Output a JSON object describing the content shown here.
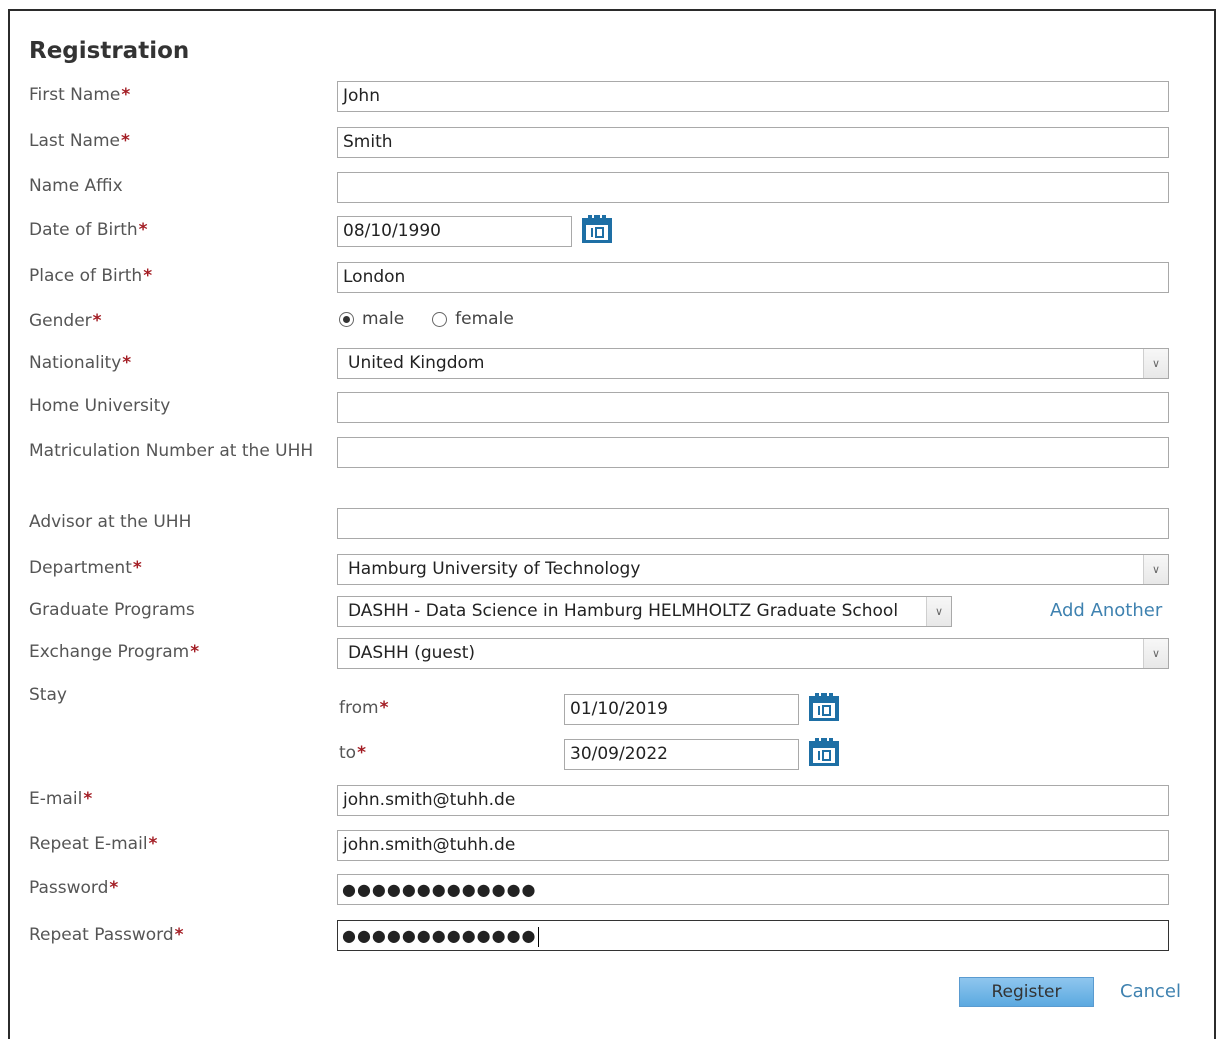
{
  "title": "Registration",
  "required_mark": "*",
  "fields": {
    "first_name": {
      "label": "First Name",
      "value": "John"
    },
    "last_name": {
      "label": "Last Name",
      "value": "Smith"
    },
    "name_affix": {
      "label": "Name Affix",
      "value": ""
    },
    "date_of_birth": {
      "label": "Date of Birth",
      "value": "08/10/1990"
    },
    "place_of_birth": {
      "label": "Place of Birth",
      "value": "London"
    },
    "gender": {
      "label": "Gender",
      "options": [
        "male",
        "female"
      ],
      "selected": "male"
    },
    "nationality": {
      "label": "Nationality",
      "value": "United Kingdom"
    },
    "home_university": {
      "label": "Home University",
      "value": ""
    },
    "matriculation_number": {
      "label": "Matriculation Number at the UHH",
      "value": ""
    },
    "advisor": {
      "label": "Advisor at the UHH",
      "value": ""
    },
    "department": {
      "label": "Department",
      "value": "Hamburg University of Technology"
    },
    "graduate_programs": {
      "label": "Graduate Programs",
      "value": "DASHH - Data Science in Hamburg HELMHOLTZ Graduate School",
      "add_another": "Add Another"
    },
    "exchange_program": {
      "label": "Exchange Program",
      "value": "DASHH (guest)"
    },
    "stay": {
      "label": "Stay",
      "from_label": "from",
      "from_value": "01/10/2019",
      "to_label": "to",
      "to_value": "30/09/2022"
    },
    "email": {
      "label": "E-mail",
      "value": "john.smith@tuhh.de"
    },
    "repeat_email": {
      "label": "Repeat E-mail",
      "value": "john.smith@tuhh.de"
    },
    "password": {
      "label": "Password",
      "value": "●●●●●●●●●●●●●"
    },
    "repeat_password": {
      "label": "Repeat Password",
      "value": "●●●●●●●●●●●●●"
    }
  },
  "buttons": {
    "register": "Register",
    "cancel": "Cancel"
  },
  "colors": {
    "required": "#a31d24",
    "link": "#3f82b0",
    "calendar": "#1e6fa5",
    "button": "#6fb4e6"
  },
  "icons": {
    "calendar": "calendar-icon",
    "dropdown": "chevron-down-icon"
  }
}
